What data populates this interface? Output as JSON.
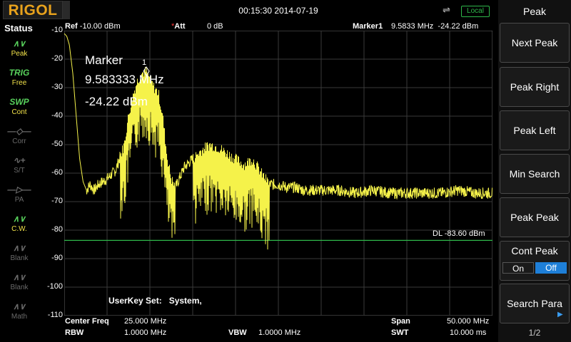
{
  "header": {
    "brand": "RIGOL",
    "datetime": "00:15:30 2014-07-19",
    "usb_icon": "usb-icon",
    "local_badge": "Local"
  },
  "status": {
    "title": "Status",
    "items": [
      {
        "icon": "peak-wave-icon",
        "glyph": "∧∨",
        "label": "Peak",
        "active": true
      },
      {
        "icon": "trig-icon",
        "glyph": "TRIG",
        "label": "Free",
        "active": true
      },
      {
        "icon": "swp-icon",
        "glyph": "SWP",
        "label": "Cont",
        "active": true
      },
      {
        "icon": "corr-icon",
        "glyph": "—◇—",
        "label": "Corr",
        "active": false
      },
      {
        "icon": "st-icon",
        "glyph": "∿+",
        "label": "S/T",
        "active": false
      },
      {
        "icon": "pa-icon",
        "glyph": "—▷—",
        "label": "PA",
        "active": false
      },
      {
        "icon": "cw-icon",
        "glyph": "∧∨",
        "label": "C.W.",
        "active": true
      },
      {
        "icon": "blank-icon",
        "glyph": "∧∨",
        "label": "Blank",
        "active": false
      },
      {
        "icon": "blank-icon",
        "glyph": "∧∨",
        "label": "Blank",
        "active": false
      },
      {
        "icon": "math-icon",
        "glyph": "∧∨",
        "label": "Math",
        "active": false
      }
    ]
  },
  "plot_header": {
    "ref": "Ref",
    "ref_value": "-10.00 dBm",
    "att_star": "*",
    "att": "Att",
    "att_value": "0 dB",
    "marker_label": "Marker1",
    "marker_value": "9.5833 MHz  -24.22 dBm"
  },
  "y_axis": {
    "ticks": [
      "-10",
      "-20",
      "-30",
      "-40",
      "-50",
      "-60",
      "-70",
      "-80",
      "-90",
      "-100",
      "-110"
    ]
  },
  "marker_box": {
    "title": "Marker",
    "freq": "9.583333 MHz",
    "level": "-24.22 dBm",
    "number": "1"
  },
  "display_line": {
    "label": "DL -83.60 dBm",
    "level_dbm": -83.6
  },
  "userkey": "UserKey Set:   System,",
  "bottom": {
    "center_freq_label": "Center Freq",
    "center_freq_value": "25.000 MHz",
    "span_label": "Span",
    "span_value": "50.000 MHz",
    "rbw_label": "RBW",
    "rbw_value": "1.0000 MHz",
    "vbw_label": "VBW",
    "vbw_value": "1.0000 MHz",
    "swt_label": "SWT",
    "swt_value": "10.000 ms"
  },
  "panel": {
    "title": "Peak",
    "buttons": [
      "Next Peak",
      "Peak Right",
      "Peak Left",
      "Min Search",
      "Peak Peak"
    ],
    "cont_peak": {
      "label": "Cont Peak",
      "on": "On",
      "off": "Off",
      "selected": "Off"
    },
    "search_para": "Search Para",
    "page": "1/2"
  },
  "colors": {
    "trace": "#f5f24a",
    "grid": "#3a3a3a",
    "display_line": "#2fb84a",
    "accent": "#1e7fd8"
  },
  "chart_data": {
    "type": "line",
    "title": "",
    "xlabel": "",
    "ylabel": "",
    "xlim": [
      0,
      50
    ],
    "ylim": [
      -110,
      -10
    ],
    "y_unit": "dBm",
    "x_unit": "MHz",
    "series": [
      {
        "x": [
          0,
          0.3,
          0.6,
          1.0,
          1.4,
          1.8,
          2.2,
          2.6,
          3.0,
          3.5,
          4.0,
          5.0,
          6.0,
          7.0,
          7.5,
          8.0,
          8.5,
          9.0,
          9.58,
          10.0,
          10.5,
          11.0,
          11.5,
          12.0,
          12.5,
          13.0,
          14.0,
          15.0,
          16.0,
          17.0,
          18.0,
          19.0,
          20.0,
          21.0,
          22.0,
          23.0,
          24.0,
          25.0,
          26.0,
          27.0,
          28.0,
          29.0,
          30.0,
          32.0,
          34.0,
          36.0,
          38.0,
          40.0,
          42.0,
          44.0,
          46.0,
          48.0,
          50.0
        ],
        "y": [
          -11,
          -12,
          -15,
          -25,
          -40,
          -55,
          -63,
          -66,
          -64,
          -66,
          -64,
          -62,
          -59,
          -50,
          -40,
          -33,
          -28,
          -25,
          -24.22,
          -27,
          -30,
          -32,
          -40,
          -54,
          -62,
          -65,
          -58,
          -55,
          -52,
          -50,
          -51,
          -53,
          -55,
          -57,
          -55,
          -60,
          -64,
          -64,
          -65,
          -65,
          -66,
          -66,
          -66,
          -66,
          -67,
          -66,
          -67,
          -67,
          -67,
          -67,
          -66,
          -67,
          -67
        ]
      }
    ],
    "markers": [
      {
        "id": "1",
        "x": 9.583333,
        "y": -24.22
      }
    ],
    "grid": true
  }
}
